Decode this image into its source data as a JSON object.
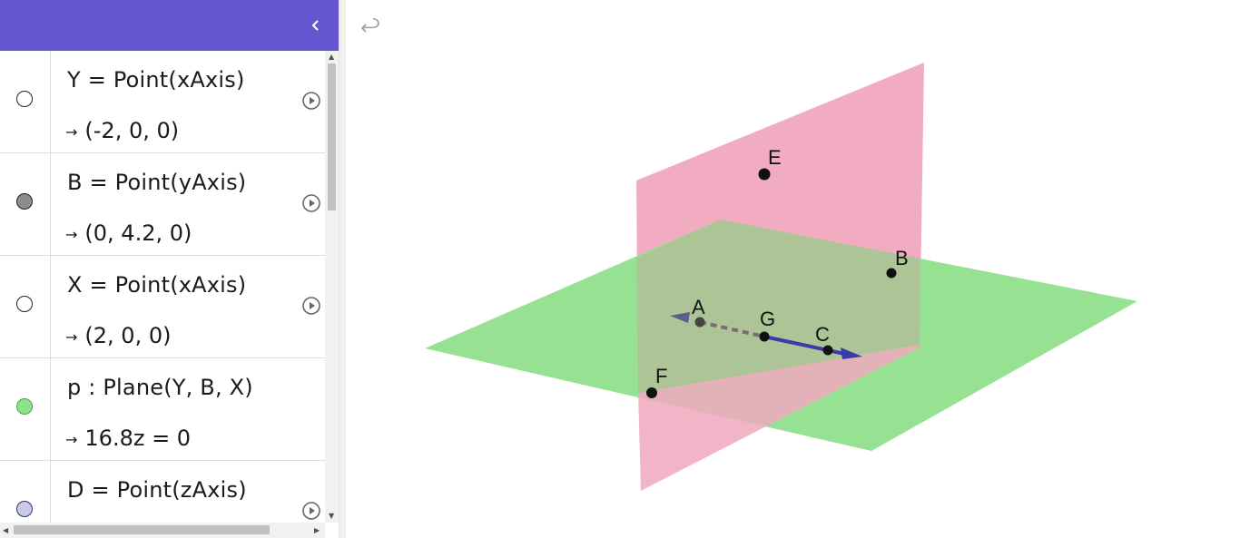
{
  "algebra": {
    "rows": [
      {
        "definition": "Y  =  Point(xAxis)",
        "value": "(-2, 0, 0)",
        "marble_color": "#ffffff",
        "marble_border": "#222222"
      },
      {
        "definition": "B  =  Point(yAxis)",
        "value": "(0, 4.2, 0)",
        "marble_color": "#8c8c8c",
        "marble_border": "#222222"
      },
      {
        "definition": "X  =  Point(xAxis)",
        "value": "(2, 0, 0)",
        "marble_color": "#ffffff",
        "marble_border": "#222222"
      },
      {
        "definition": "p : Plane(Y, B, X)",
        "value": "16.8z  =  0",
        "marble_color": "#8fe08f",
        "marble_border": "#3fa83f"
      },
      {
        "definition": "D  =  Point(zAxis)",
        "value": "",
        "marble_color": "#c8c8e8",
        "marble_border": "#333366"
      }
    ],
    "value_arrow": "→"
  },
  "icons": {
    "collapse": "chevron-left-icon",
    "play": "play-circle-icon",
    "undo": "undo-icon"
  },
  "colors": {
    "header": "#6557d2",
    "plane_horizontal": "#8fdf8a",
    "plane_vertical": "#f0a8be",
    "vector": "#3b3ba8"
  },
  "scene": {
    "points": [
      {
        "label": "E"
      },
      {
        "label": "B"
      },
      {
        "label": "A"
      },
      {
        "label": "G"
      },
      {
        "label": "C"
      },
      {
        "label": "F"
      }
    ]
  }
}
